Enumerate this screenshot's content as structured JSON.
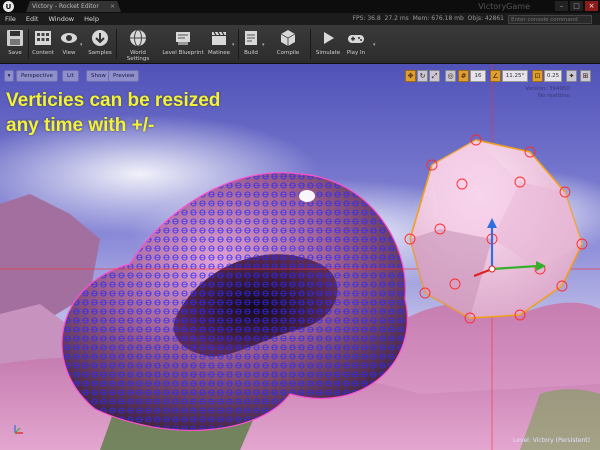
{
  "titlebar": {
    "tab_label": "Victory - Rocket Editor",
    "project_name": "VictoryGame"
  },
  "menu": {
    "items": [
      "File",
      "Edit",
      "Window",
      "Help"
    ]
  },
  "stats": {
    "fps": "FPS: 36.8",
    "ms": "27.2 ms",
    "mem": "Mem: 676.18 mb",
    "objs": "Objs: 42861"
  },
  "console": {
    "placeholder": "Enter console command"
  },
  "toolbar": {
    "save": "Save",
    "content": "Content",
    "view": "View",
    "samples": "Samples",
    "world_settings": "World Settings",
    "level_blueprint": "Level Blueprint",
    "matinee": "Matinee",
    "build": "Build",
    "compile": "Compile",
    "simulate": "Simulate",
    "play_in": "Play In"
  },
  "viewport": {
    "perspective": "Perspective",
    "lit": "Lit",
    "show": "Show",
    "preview": "Preview",
    "grid_snap": "16",
    "rot_snap": "11.25°",
    "scale_snap": "0.25",
    "info_line1": "Version: 394950",
    "info_line2": "No realtime",
    "caption_line1": "Verticies can be resized",
    "caption_line2": "any time with +/-",
    "level_label": "Level: Victory (Persistent)"
  },
  "colors": {
    "caption": "#f2f23a",
    "selection": "#f0a020",
    "vertex": "#2a2aff"
  }
}
